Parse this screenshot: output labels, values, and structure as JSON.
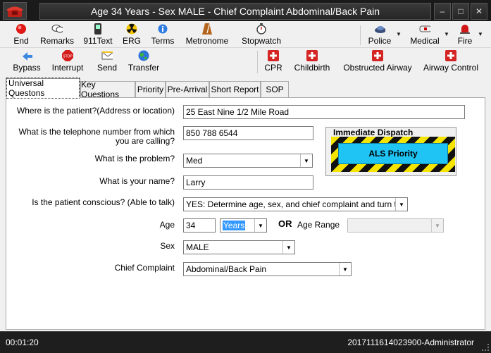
{
  "window": {
    "title": "Age 34 Years - Sex MALE - Chief Complaint Abdominal/Back Pain",
    "minimize": "–",
    "maximize": "□",
    "close": "✕"
  },
  "toolbar1": {
    "end": "End",
    "remarks": "Remarks",
    "text911": "911Text",
    "erg": "ERG",
    "terms": "Terms",
    "metronome": "Metronome",
    "stopwatch": "Stopwatch",
    "police": "Police",
    "medical": "Medical",
    "fire": "Fire"
  },
  "toolbar2": {
    "bypass": "Bypass",
    "interrupt": "Interrupt",
    "send": "Send",
    "transfer": "Transfer",
    "cpr": "CPR",
    "childbirth": "Childbirth",
    "obstructed_airway": "Obstructed Airway",
    "airway_control": "Airway Control"
  },
  "tabs": [
    "Universal Questons",
    "Key Questions",
    "Priority",
    "Pre-Arrival",
    "Short Report",
    "SOP"
  ],
  "form": {
    "location_label": "Where is the patient?(Address or location)",
    "location_value": "25 East Nine 1/2 Mile Road",
    "phone_label_1": "What is the telephone number from which",
    "phone_label_2": "you are calling?",
    "phone_value": "850 788 6544",
    "problem_label": "What is the problem?",
    "problem_value": "Med",
    "name_label": "What is your name?",
    "name_value": "Larry",
    "conscious_label": "Is the patient conscious? (Able to talk)",
    "conscious_value": "YES:  Determine age, sex, and chief complaint and turn to appr",
    "age_label": "Age",
    "age_value": "34",
    "age_unit": "Years",
    "or_label": "OR",
    "age_range_label": "Age Range",
    "age_range_value": "",
    "sex_label": "Sex",
    "sex_value": "MALE",
    "complaint_label": "Chief Complaint",
    "complaint_value": "Abdominal/Back Pain"
  },
  "dispatch": {
    "title": "Immediate Dispatch",
    "button": "ALS Priority"
  },
  "status": {
    "timer": "00:01:20",
    "session": "2017111614023900-Administrator"
  },
  "colors": {
    "als_button": "#1fc4f4",
    "hazard_yellow": "#f5e400",
    "selection": "#3399ff"
  }
}
